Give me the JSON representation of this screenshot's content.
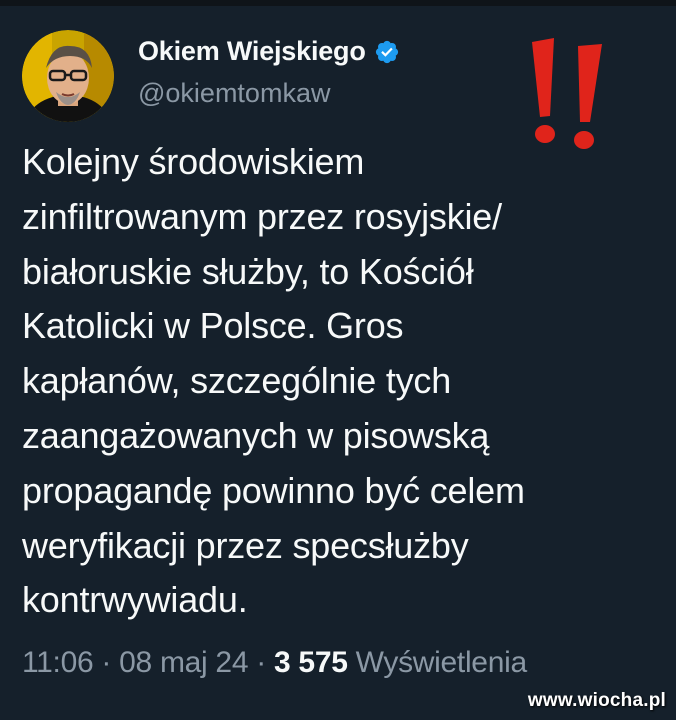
{
  "author": {
    "display_name": "Okiem Wiejskiego",
    "handle": "@okiemtomkaw",
    "avatar": "avatar",
    "verified_icon": "verified-badge-icon",
    "verified_color": "#1d9bf0"
  },
  "decoration": {
    "icon": "double-exclamation-icon",
    "color": "#e0241b"
  },
  "tweet": {
    "text": "Kolejny środowiskiem\nzinfiltrowanym przez rosyjskie/\nbiałoruskie służby, to Kościół\nKatolicki w Polsce. Gros\nkapłanów, szczególnie tych\nzaangażowanych w pisowską\npropagandę powinno być celem\nweryfikacji przez specsłużby\nkontrwywiadu."
  },
  "meta": {
    "time": "11:06",
    "date": "08 maj 24",
    "views_count": "3 575",
    "views_label": "Wyświetlenia",
    "separator": "·"
  },
  "watermark": "www.wiocha.pl",
  "colors": {
    "background": "#15202b",
    "text": "#f7f9f9",
    "secondary_text": "#8b98a5"
  }
}
